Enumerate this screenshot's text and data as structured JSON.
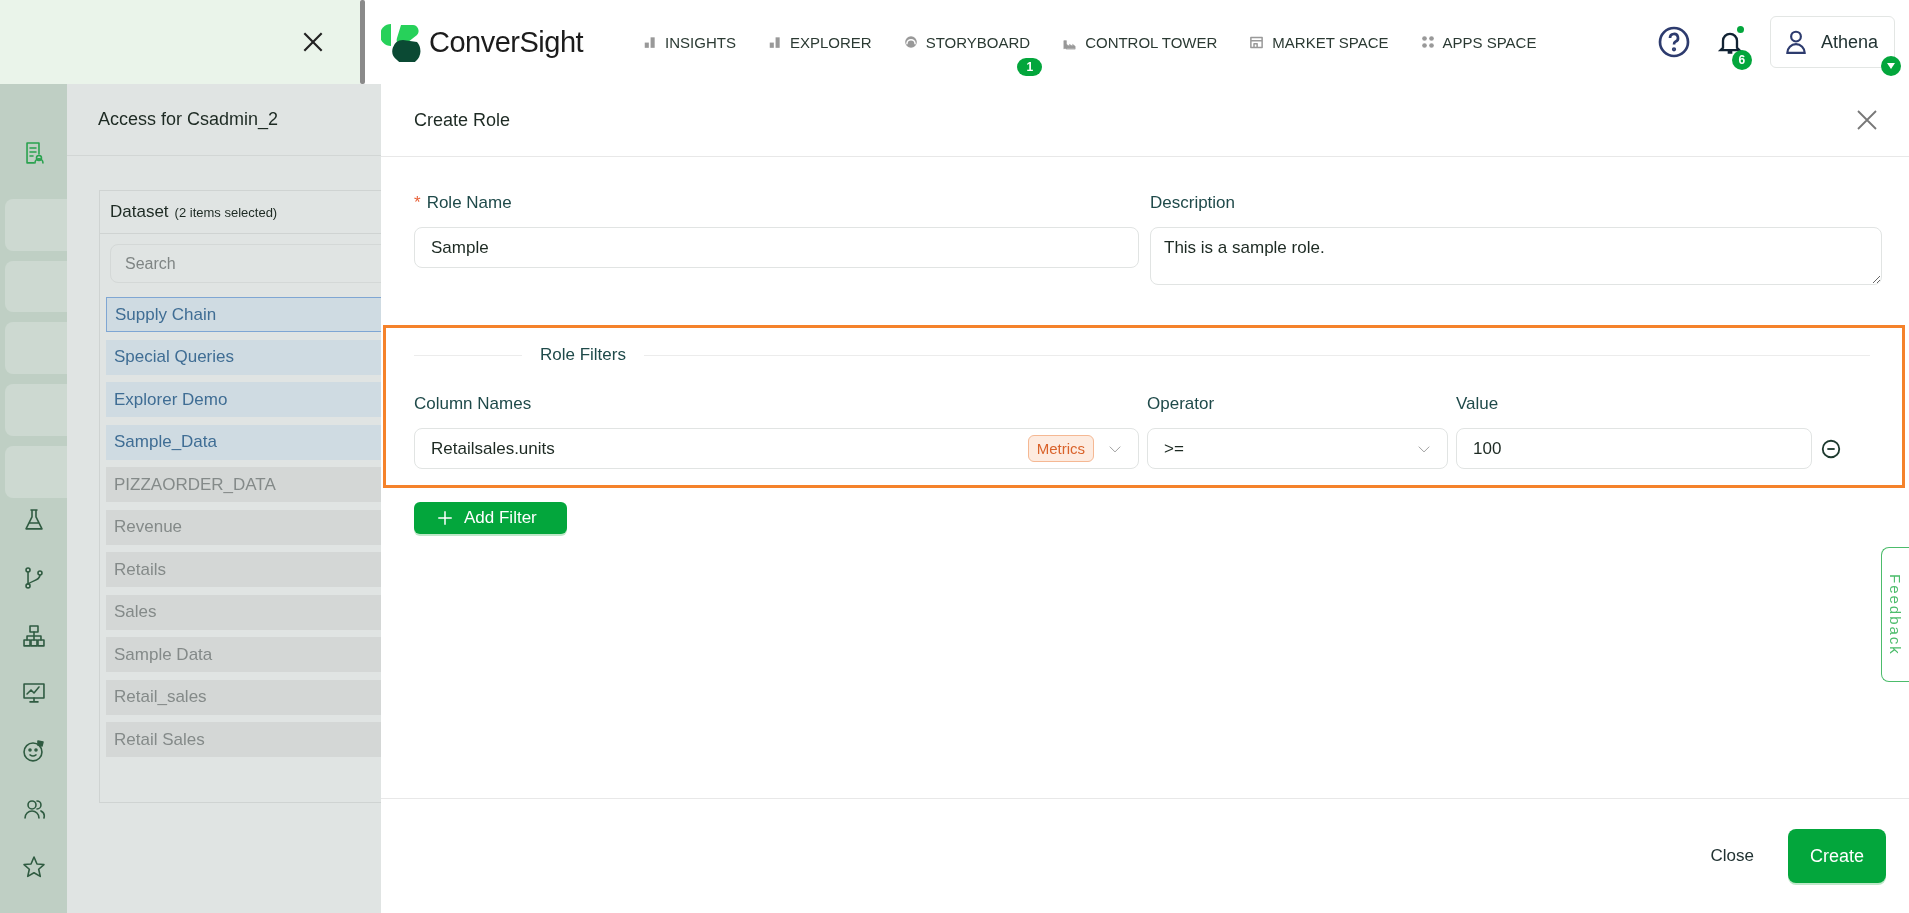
{
  "top_bar": {
    "logo_text": "ConverSight",
    "nav": [
      {
        "label": "INSIGHTS"
      },
      {
        "label": "EXPLORER"
      },
      {
        "label": "STORYBOARD",
        "badge": "1"
      },
      {
        "label": "CONTROL TOWER"
      },
      {
        "label": "MARKET SPACE"
      },
      {
        "label": "APPS SPACE"
      }
    ],
    "notification_count": "6",
    "user": "Athena"
  },
  "rail": {
    "items": [
      {
        "kind": "icon",
        "selected": true
      },
      {
        "kind": "blank"
      },
      {
        "kind": "blank"
      },
      {
        "kind": "blank"
      },
      {
        "kind": "blank"
      },
      {
        "kind": "blank"
      },
      {
        "kind": "icon",
        "selected": false
      },
      {
        "kind": "icon",
        "selected": false
      },
      {
        "kind": "icon",
        "selected": false
      },
      {
        "kind": "icon",
        "selected": false
      },
      {
        "kind": "icon",
        "selected": false
      },
      {
        "kind": "icon",
        "selected": false
      },
      {
        "kind": "icon",
        "selected": false
      }
    ]
  },
  "access_panel": {
    "title": "Access for Csadmin_2",
    "dataset": {
      "title": "Dataset",
      "count": "(2 items selected)",
      "search": {
        "placeholder": "Search"
      },
      "items": [
        {
          "label": "Supply Chain",
          "selected": true
        },
        {
          "label": "Special Queries",
          "selected": true
        },
        {
          "label": "Explorer Demo",
          "selected": true
        },
        {
          "label": "Sample_Data",
          "selected": true
        },
        {
          "label": "PIZZAORDER_DATA",
          "selected": false
        },
        {
          "label": "Revenue",
          "selected": false
        },
        {
          "label": "Retails",
          "selected": false
        },
        {
          "label": "Sales",
          "selected": false
        },
        {
          "label": "Sample Data",
          "selected": false
        },
        {
          "label": "Retail_sales",
          "selected": false
        },
        {
          "label": "Retail Sales",
          "selected": false
        }
      ]
    }
  },
  "modal": {
    "title": "Create Role",
    "role_name": {
      "label": "Role Name",
      "required_mark": "*",
      "value": "Sample"
    },
    "description": {
      "label": "Description",
      "value": "This is a sample role."
    },
    "role_filters": {
      "title": "Role Filters",
      "highlighted": true,
      "headers": [
        "Column Names",
        "Operator",
        "Value"
      ],
      "rows": [
        {
          "column": "Retailsales.units",
          "tag": "Metrics",
          "operator": ">=",
          "value": "100"
        }
      ]
    },
    "add_filter": "Add Filter",
    "close": "Close",
    "create": "Create"
  },
  "feedback": "Feedback"
}
